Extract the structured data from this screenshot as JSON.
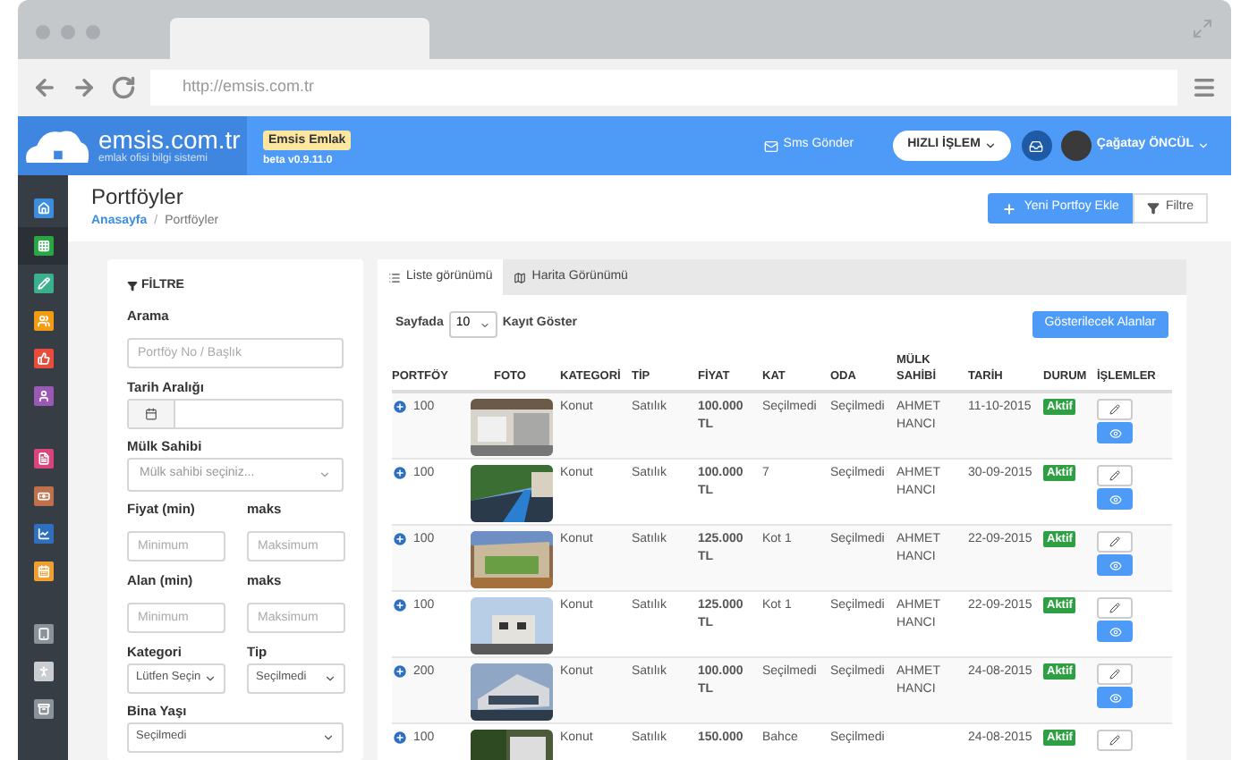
{
  "browser": {
    "url": "http://emsis.com.tr"
  },
  "header": {
    "logo": "emsis.com.tr",
    "tagline": "emlak ofisi bilgi sistemi",
    "badge": "Emsis Emlak",
    "version": "beta v0.9.11.0",
    "sms": "Sms Gönder",
    "quick": "HIZLI İŞLEM",
    "user": "Çağatay ÖNCÜL"
  },
  "sidebar": {
    "items": [
      {
        "color": "#3c8dde",
        "selected": false
      },
      {
        "color": "#29a745",
        "selected": true
      },
      {
        "color": "#3bb08f",
        "selected": false
      },
      {
        "color": "#f39c12",
        "selected": false
      },
      {
        "color": "#e74c3c",
        "selected": false
      },
      {
        "color": "#9b59b6",
        "selected": false
      },
      {
        "color": "#d9457a",
        "selected": false
      },
      {
        "color": "#c0704a",
        "selected": false
      },
      {
        "color": "#2f6fbf",
        "selected": false
      },
      {
        "color": "#f0a030",
        "selected": false
      },
      {
        "color": "#8a939b",
        "selected": false
      },
      {
        "color": "#c9cdd1",
        "selected": false
      },
      {
        "color": "#8a939b",
        "selected": false
      }
    ]
  },
  "page": {
    "title": "Portföyler",
    "breadcrumb": [
      "Anasayfa",
      "Portföyler"
    ],
    "breadcrumb_separator": "/",
    "add_button": "Yeni Portfoy Ekle",
    "filter_button": "Filtre"
  },
  "filter": {
    "title": "FİLTRE",
    "search": {
      "label": "Arama",
      "placeholder": "Portföy No / Başlık"
    },
    "date": {
      "label": "Tarih Aralığı"
    },
    "owner": {
      "label": "Mülk Sahibi",
      "placeholder": "Mülk sahibi seçiniz..."
    },
    "price": {
      "label": "Fiyat (min)",
      "max_label": "maks",
      "placeholder": "Minimum",
      "max_placeholder": "Maksimum"
    },
    "area": {
      "label": "Alan (min)",
      "max_label": "maks",
      "placeholder": "Minimum",
      "max_placeholder": "Maksimum"
    },
    "category": {
      "label": "Kategori",
      "value": "Lütfen Seçin"
    },
    "type": {
      "label": "Tip",
      "value": "Seçilmedi"
    },
    "age": {
      "label": "Bina Yaşı",
      "value": "Seçilmedi"
    }
  },
  "tabs": [
    {
      "label": "Liste görünümü",
      "selected": true
    },
    {
      "label": "Harita Görünümü",
      "selected": false
    }
  ],
  "list": {
    "per_page_label": "Sayfada",
    "per_page": "10",
    "per_page_suffix": "Kayıt Göster",
    "columns_button": "Gösterilecek Alanlar"
  },
  "table": {
    "columns": [
      "PORTFÖY",
      "FOTO",
      "KATEGORİ",
      "TİP",
      "FİYAT",
      "KAT",
      "ODA",
      "MÜLK SAHİBİ",
      "TARİH",
      "DURUM",
      "İŞLEMLER"
    ],
    "rows": [
      {
        "portfolio": "100",
        "category": "Konut",
        "type": "Satılık",
        "price": "100.000 TL",
        "floor": "Seçilmedi",
        "room": "Seçilmedi",
        "owner": "AHMET HANCI",
        "date": "11-10-2015",
        "status": "Aktif"
      },
      {
        "portfolio": "100",
        "category": "Konut",
        "type": "Satılık",
        "price": "100.000 TL",
        "floor": "7",
        "room": "Seçilmedi",
        "owner": "AHMET HANCI",
        "date": "30-09-2015",
        "status": "Aktif"
      },
      {
        "portfolio": "100",
        "category": "Konut",
        "type": "Satılık",
        "price": "125.000 TL",
        "floor": "Kot 1",
        "room": "Seçilmedi",
        "owner": "AHMET HANCI",
        "date": "22-09-2015",
        "status": "Aktif"
      },
      {
        "portfolio": "100",
        "category": "Konut",
        "type": "Satılık",
        "price": "125.000 TL",
        "floor": "Kot 1",
        "room": "Seçilmedi",
        "owner": "AHMET HANCI",
        "date": "22-09-2015",
        "status": "Aktif"
      },
      {
        "portfolio": "200",
        "category": "Konut",
        "type": "Satılık",
        "price": "100.000 TL",
        "floor": "Seçilmedi",
        "room": "Seçilmedi",
        "owner": "AHMET HANCI",
        "date": "24-08-2015",
        "status": "Aktif"
      },
      {
        "portfolio": "100",
        "category": "Konut",
        "type": "Satılık",
        "price": "150.000",
        "floor": "Bahce",
        "room": "Seçilmedi",
        "date": "24-08-2015",
        "status": "Aktif"
      }
    ]
  }
}
